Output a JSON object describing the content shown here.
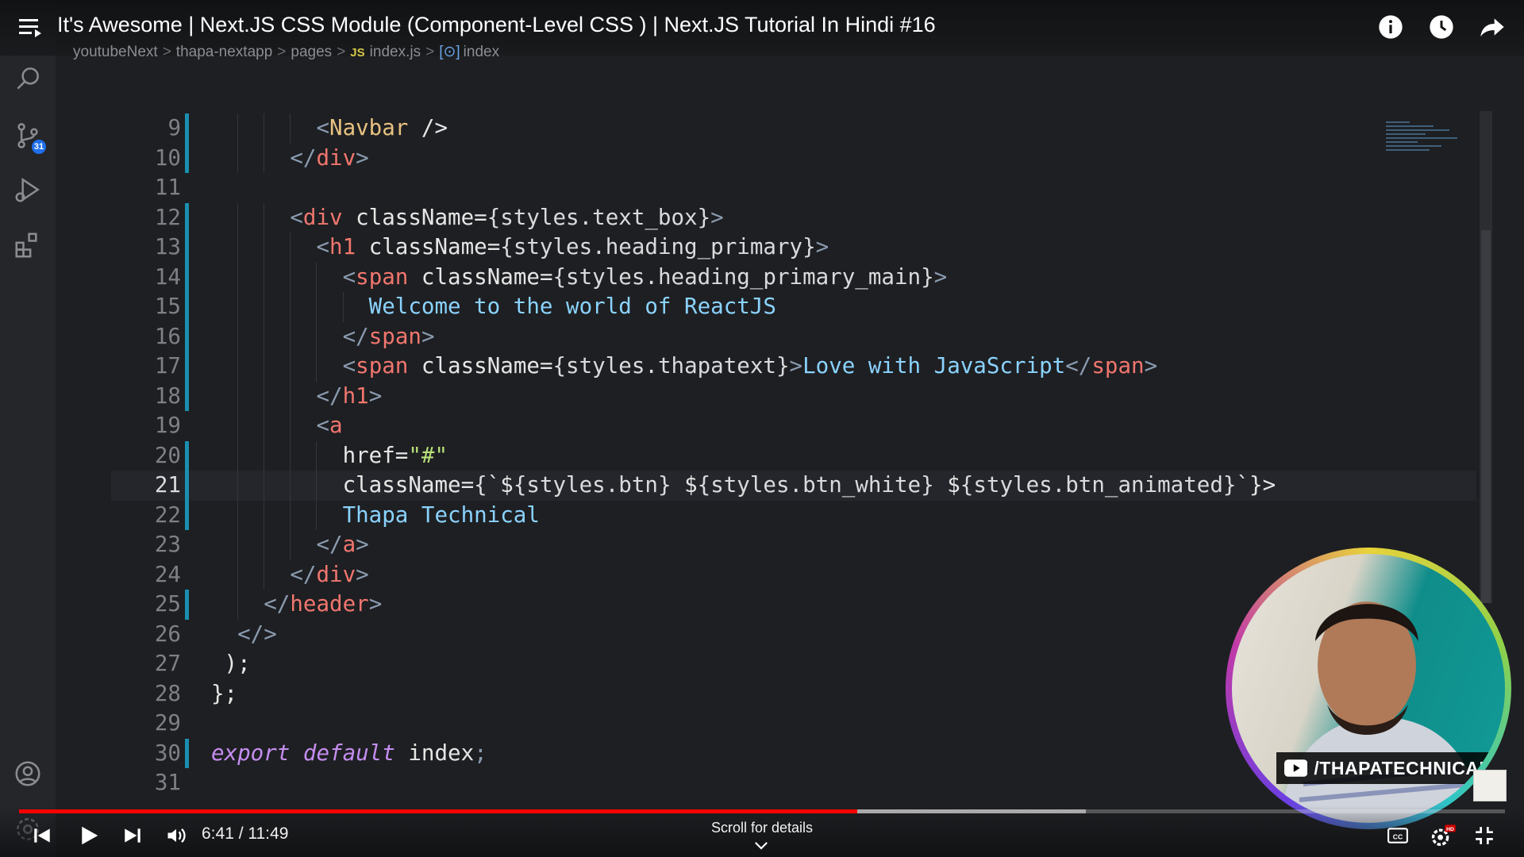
{
  "video": {
    "title": "It's Awesome | Next.JS CSS Module (Component-Level CSS ) | Next.JS Tutorial In Hindi #16",
    "time_display": "6:41 / 11:49",
    "progress": 0.564,
    "buffered": 0.718,
    "scroll_hint": "Scroll for details"
  },
  "breadcrumb": {
    "items": [
      "youtubeNext",
      "thapa-nextapp",
      "pages",
      "index.js",
      "index"
    ],
    "js_badge": "JS",
    "symbol_badge": "[⊙]"
  },
  "activity_bar": {
    "source_control_badge": "31",
    "icons": [
      "explorer-icon",
      "search-icon",
      "source-control-icon",
      "run-debug-icon",
      "extensions-icon",
      "account-icon",
      "settings-icon"
    ]
  },
  "code": {
    "active_line": 21,
    "lines": [
      {
        "n": "9",
        "text": "        <Navbar />"
      },
      {
        "n": "10",
        "text": "      </div>"
      },
      {
        "n": "11",
        "text": ""
      },
      {
        "n": "12",
        "text": "      <div className={styles.text_box}>"
      },
      {
        "n": "13",
        "text": "        <h1 className={styles.heading_primary}>"
      },
      {
        "n": "14",
        "text": "          <span className={styles.heading_primary_main}>"
      },
      {
        "n": "15",
        "text": "            Welcome to the world of ReactJS"
      },
      {
        "n": "16",
        "text": "          </span>"
      },
      {
        "n": "17",
        "text": "          <span className={styles.thapatext}>Love with JavaScript</span>"
      },
      {
        "n": "18",
        "text": "        </h1>"
      },
      {
        "n": "19",
        "text": "        <a"
      },
      {
        "n": "20",
        "text": "          href=\"#\""
      },
      {
        "n": "21",
        "text": "          className={`${styles.btn} ${styles.btn_white} ${styles.btn_animated}`}>"
      },
      {
        "n": "22",
        "text": "          Thapa Technical"
      },
      {
        "n": "23",
        "text": "        </a>"
      },
      {
        "n": "24",
        "text": "      </div>"
      },
      {
        "n": "25",
        "text": "    </header>"
      },
      {
        "n": "26",
        "text": "  </>"
      },
      {
        "n": "27",
        "text": " );"
      },
      {
        "n": "28",
        "text": "};"
      },
      {
        "n": "29",
        "text": ""
      },
      {
        "n": "30",
        "text": "export default index;"
      },
      {
        "n": "31",
        "text": ""
      }
    ]
  },
  "webcam": {
    "channel_handle": "/THAPATECHNICAL"
  },
  "colors": {
    "progress": "#ff0000",
    "gutter_modified": "#1a8fb0",
    "tag": "#f0766e",
    "attribute": "#c58df0",
    "jsx_text": "#8ad3ff"
  }
}
